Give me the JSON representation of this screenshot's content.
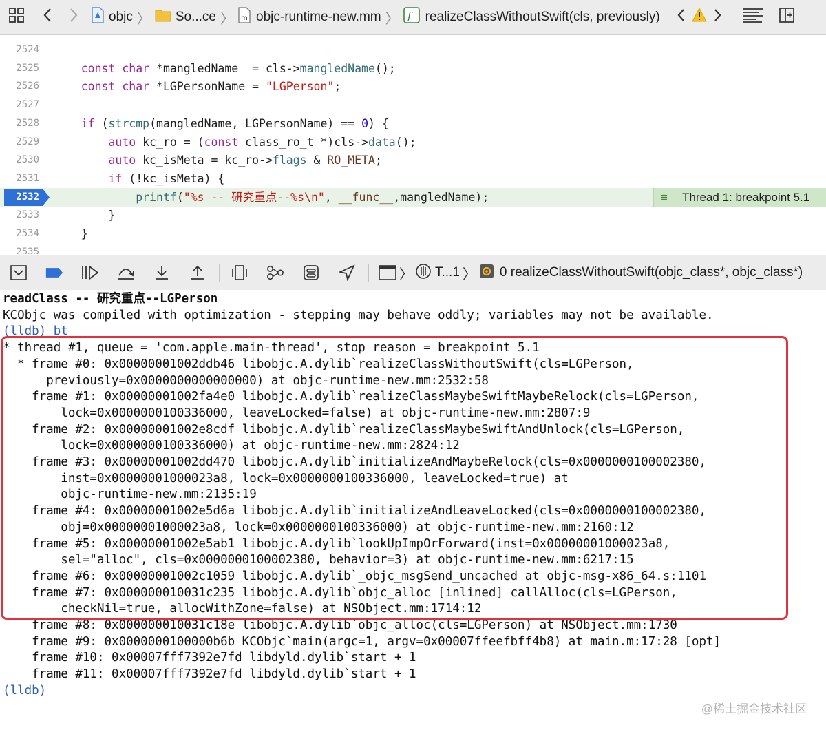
{
  "jumpbar": {
    "crumbs": [
      "objc",
      "So...ce",
      "objc-runtime-new.mm",
      "realizeClassWithoutSwift(cls, previously)"
    ]
  },
  "editor": {
    "lines": [
      {
        "n": "2524",
        "html": ""
      },
      {
        "n": "2525",
        "html": "    <span class='kw'>const char</span> *mangledName  = cls-&gt;<span class='call'>mangledName</span>();"
      },
      {
        "n": "2526",
        "html": "    <span class='kw'>const char</span> *LGPersonName = <span class='str'>\"LGPerson\"</span>;"
      },
      {
        "n": "2527",
        "html": ""
      },
      {
        "n": "2528",
        "html": "    <span class='kw'>if</span> (<span class='call'>strcmp</span>(mangledName, LGPersonName) == <span class='num'>0</span>) {"
      },
      {
        "n": "2529",
        "html": "        <span class='kw'>auto</span> kc_ro = (<span class='kw'>const</span> class_ro_t *)cls-&gt;<span class='call'>data</span>();"
      },
      {
        "n": "2530",
        "html": "        <span class='kw'>auto</span> kc_isMeta = kc_ro-&gt;<span class='call'>flags</span> &amp; <span class='mac'>RO_META</span>;"
      },
      {
        "n": "2531",
        "html": "        <span class='kw'>if</span> (!kc_isMeta) {"
      },
      {
        "n": "2532",
        "html": "            <span class='call'>printf</span>(<span class='str'>\"%s -- 研究重点--%s\\n\"</span>, <span class='mac'>__func__</span>,mangledName);",
        "current": true
      },
      {
        "n": "2533",
        "html": "        }"
      },
      {
        "n": "2534",
        "html": "    }"
      },
      {
        "n": "2535",
        "html": ""
      }
    ],
    "breakpoint_label": "Thread 1: breakpoint 5.1"
  },
  "debugbar": {
    "thread_label": "T...1",
    "frame_label": "0 realizeClassWithoutSwift(objc_class*, objc_class*)"
  },
  "console": {
    "lines": [
      {
        "t": "readClass -- 研究重点--LGPerson",
        "bold": true
      },
      {
        "t": "KCObjc was compiled with optimization - stepping may behave oddly; variables may not be available."
      },
      {
        "t": "(lldb) bt",
        "prompt": true
      },
      {
        "t": "* thread #1, queue = 'com.apple.main-thread', stop reason = breakpoint 5.1"
      },
      {
        "t": "  * frame #0: 0x00000001002ddb46 libobjc.A.dylib`realizeClassWithoutSwift(cls=LGPerson,"
      },
      {
        "t": "      previously=0x0000000000000000) at objc-runtime-new.mm:2532:58"
      },
      {
        "t": "    frame #1: 0x00000001002fa4e0 libobjc.A.dylib`realizeClassMaybeSwiftMaybeRelock(cls=LGPerson,"
      },
      {
        "t": "        lock=0x0000000100336000, leaveLocked=false) at objc-runtime-new.mm:2807:9"
      },
      {
        "t": "    frame #2: 0x00000001002e8cdf libobjc.A.dylib`realizeClassMaybeSwiftAndUnlock(cls=LGPerson,"
      },
      {
        "t": "        lock=0x0000000100336000) at objc-runtime-new.mm:2824:12"
      },
      {
        "t": "    frame #3: 0x00000001002dd470 libobjc.A.dylib`initializeAndMaybeRelock(cls=0x0000000100002380,"
      },
      {
        "t": "        inst=0x00000001000023a8, lock=0x0000000100336000, leaveLocked=true) at"
      },
      {
        "t": "        objc-runtime-new.mm:2135:19"
      },
      {
        "t": "    frame #4: 0x00000001002e5d6a libobjc.A.dylib`initializeAndLeaveLocked(cls=0x0000000100002380,"
      },
      {
        "t": "        obj=0x00000001000023a8, lock=0x0000000100336000) at objc-runtime-new.mm:2160:12"
      },
      {
        "t": "    frame #5: 0x00000001002e5ab1 libobjc.A.dylib`lookUpImpOrForward(inst=0x00000001000023a8,"
      },
      {
        "t": "        sel=\"alloc\", cls=0x0000000100002380, behavior=3) at objc-runtime-new.mm:6217:15"
      },
      {
        "t": "    frame #6: 0x00000001002c1059 libobjc.A.dylib`_objc_msgSend_uncached at objc-msg-x86_64.s:1101"
      },
      {
        "t": "    frame #7: 0x000000010031c235 libobjc.A.dylib`objc_alloc [inlined] callAlloc(cls=LGPerson,"
      },
      {
        "t": "        checkNil=true, allocWithZone=false) at NSObject.mm:1714:12"
      },
      {
        "t": "    frame #8: 0x000000010031c18e libobjc.A.dylib`objc_alloc(cls=LGPerson) at NSObject.mm:1730"
      },
      {
        "t": "    frame #9: 0x0000000100000b6b KCObjc`main(argc=1, argv=0x00007ffeefbff4b8) at main.m:17:28 [opt]"
      },
      {
        "t": "    frame #10: 0x00007fff7392e7fd libdyld.dylib`start + 1"
      },
      {
        "t": "    frame #11: 0x00007fff7392e7fd libdyld.dylib`start + 1"
      },
      {
        "t": "(lldb)",
        "prompt": true
      }
    ]
  },
  "watermark": "@稀土掘金技术社区",
  "colors": {
    "highlight": "#e8f2e6",
    "breakpoint": "#2f70d8",
    "annotation": "#cfe6c8",
    "redbox": "#e0323e"
  }
}
